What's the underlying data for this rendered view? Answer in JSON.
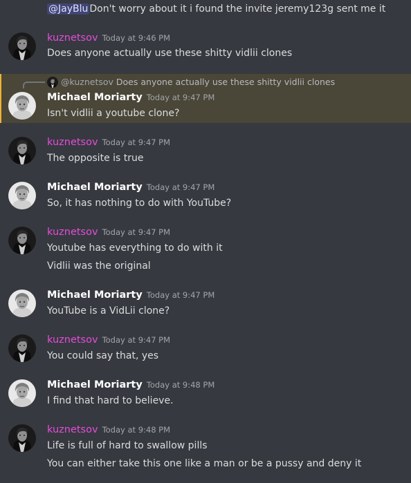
{
  "top_message": {
    "mention": "@JayBlu",
    "text": "Don't worry about it i found the invite jeremy123g sent me it"
  },
  "users": {
    "kuznetsov": {
      "name": "kuznetsov",
      "color": "#e74cdd"
    },
    "moriarty": {
      "name": "Michael Moriarty",
      "color": "#ffffff"
    }
  },
  "messages": [
    {
      "author": "kuznetsov",
      "timestamp": "Today at 9:46 PM",
      "lines": [
        "Does anyone actually use these shitty vidlii clones"
      ]
    },
    {
      "author": "Michael Moriarty",
      "timestamp": "Today at 9:47 PM",
      "reply": {
        "mention": "@kuznetsov",
        "text": "Does anyone actually use these shitty vidlii clones"
      },
      "lines": [
        "Isn't vidlii a youtube clone?"
      ]
    },
    {
      "author": "kuznetsov",
      "timestamp": "Today at 9:47 PM",
      "lines": [
        "The opposite is true"
      ]
    },
    {
      "author": "Michael Moriarty",
      "timestamp": "Today at 9:47 PM",
      "lines": [
        "So, it has nothing to do with YouTube?"
      ]
    },
    {
      "author": "kuznetsov",
      "timestamp": "Today at 9:47 PM",
      "lines": [
        "Youtube has everything to do with it",
        "Vidlii was the original"
      ]
    },
    {
      "author": "Michael Moriarty",
      "timestamp": "Today at 9:47 PM",
      "lines": [
        "YouTube is a VidLii clone?"
      ]
    },
    {
      "author": "kuznetsov",
      "timestamp": "Today at 9:47 PM",
      "lines": [
        "You could say that, yes"
      ]
    },
    {
      "author": "Michael Moriarty",
      "timestamp": "Today at 9:48 PM",
      "lines": [
        "I find that hard to believe."
      ]
    },
    {
      "author": "kuznetsov",
      "timestamp": "Today at 9:48 PM",
      "lines": [
        "Life is full of hard to swallow pills",
        "You can either take this one like a man or be a pussy and deny it"
      ]
    }
  ],
  "colors": {
    "background": "#36393f",
    "highlight": "#4a4638",
    "kuznetsov_name": "#e74cdd",
    "timestamp": "#a3a6aa"
  },
  "icons": {
    "kuznetsov_avatar": "dark-portrait-avatar",
    "moriarty_avatar": "light-portrait-avatar"
  }
}
